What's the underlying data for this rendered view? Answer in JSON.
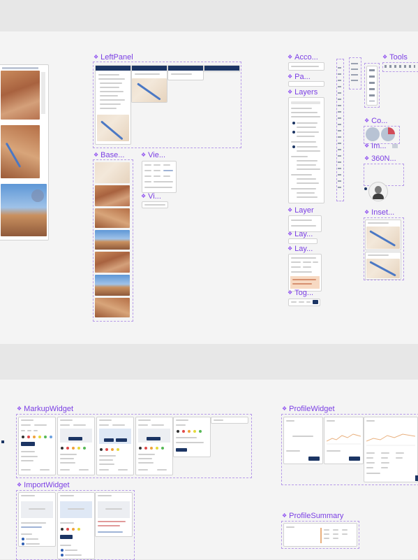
{
  "components": {
    "left_panel": "LeftPanel",
    "base": "Base...",
    "vie": "Vie...",
    "vi": "Vi...",
    "acco": "Acco...",
    "pa": "Pa...",
    "layers": "Layers",
    "layer": "Layer",
    "lay1": "Lay...",
    "lay2": "Lay...",
    "tog": "Tog...",
    "tools": "Tools",
    "co": "Co...",
    "im": "Im...",
    "n360": "360N...",
    "inset": "Inset...",
    "markup_widget": "MarkupWidget",
    "import_widget": "ImportWidget",
    "profile_widget": "ProfileWidget",
    "profile_summary": "ProfileSummary"
  },
  "colors": {
    "component_title": "#7b3fe4",
    "frame_border": "#b79be8",
    "header_navy": "#1c3564",
    "canvas_gray": "#e7e7e7",
    "band_light": "#f4f4f4"
  },
  "icons": {
    "component": "diamond-component-icon"
  }
}
